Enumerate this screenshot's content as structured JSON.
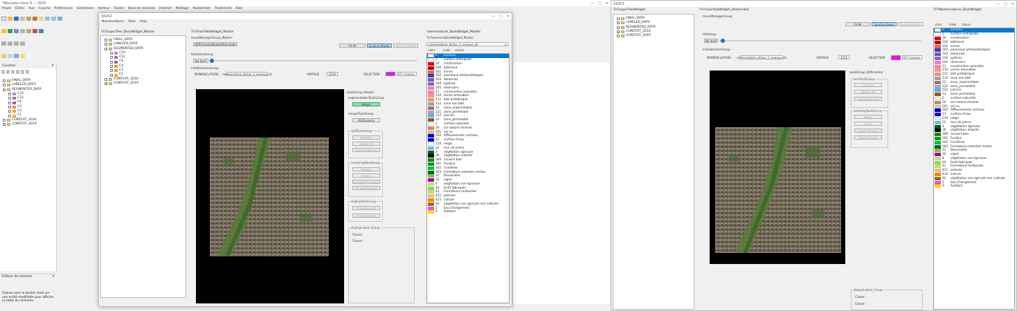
{
  "main_window": {
    "title": "*Nouveau zone 9 — QGIS",
    "menu": [
      "Projet",
      "Éditer",
      "Vue",
      "Couche",
      "Préférences",
      "Extensions",
      "Vecteur",
      "Raster",
      "Base de données",
      "Internet",
      "Maillage",
      "Rasterstats",
      "Traitement",
      "Aide"
    ],
    "layers_panel_title": "Couches",
    "layers": [
      {
        "name": "FINAL_DATA",
        "checked": false,
        "indent": 1
      },
      {
        "name": "LABELED_DATA",
        "checked": false,
        "indent": 1
      },
      {
        "name": "SEGMENTED_DATA",
        "checked": false,
        "indent": 1
      },
      {
        "name": "C10",
        "checked": false,
        "indent": 2,
        "color": "#b088c8"
      },
      {
        "name": "C12",
        "checked": false,
        "indent": 2,
        "color": "#a070b8"
      },
      {
        "name": "C6",
        "checked": false,
        "indent": 2,
        "color": "#9060a8"
      },
      {
        "name": "C4",
        "checked": false,
        "indent": 2,
        "color": "#d0a040"
      },
      {
        "name": "C2",
        "checked": false,
        "indent": 2,
        "color": "#e8a030"
      },
      {
        "name": "C1",
        "checked": false,
        "indent": 2,
        "color": "#f0b030"
      },
      {
        "name": "CONTEXT_2016",
        "checked": false,
        "indent": 1
      },
      {
        "name": "CONTEXT_2019",
        "checked": true,
        "indent": 1
      }
    ],
    "vertex_editor_title": "Éditeur de sommet",
    "vertex_editor_text": "Cliquez avec le bouton droit sur une entité modifiable pour afficher sa table de sommets."
  },
  "qgis_dialog": {
    "title": "QGIS3",
    "menu": [
      "Nomenclature",
      "Tools",
      "Help"
    ],
    "layer_tree_title": "TnTLayerTree_DockWidget_Master",
    "layers": [
      {
        "name": "FINAL_DATA",
        "checked": false,
        "indent": 1
      },
      {
        "name": "LABELED_DATA",
        "checked": false,
        "indent": 1
      },
      {
        "name": "SEGMENTED_DATA",
        "checked": false,
        "indent": 1
      },
      {
        "name": "C10",
        "checked": false,
        "indent": 2,
        "color": "#b088c8"
      },
      {
        "name": "C12",
        "checked": false,
        "indent": 2,
        "color": "#a070b8"
      },
      {
        "name": "C6",
        "checked": false,
        "indent": 2,
        "color": "#9060a8"
      },
      {
        "name": "C4",
        "checked": false,
        "indent": 2,
        "color": "#d0a040"
      },
      {
        "name": "C2",
        "checked": false,
        "indent": 2,
        "color": "#e8a030"
      },
      {
        "name": "C1",
        "checked": false,
        "indent": 2,
        "color": "#f0b030"
      },
      {
        "name": "CONTEXT_2016",
        "checked": false,
        "indent": 1
      },
      {
        "name": "CONTEXT_2019",
        "checked": true,
        "indent": 1
      }
    ],
    "center_title": "TnTmainToolWidget_Master",
    "move_group": "moveManagerGroup_Master",
    "refresh_btn": "AllTrCentroidSpatialReg mode",
    "fit_all": "Fit All",
    "synchro_btn": "Synchro Master",
    "synchro_slave": "Synchro Slave",
    "select_group": "tileSelectGroup",
    "no_level": "No level",
    "info_group": "infoSelectionGroup",
    "nomenclature_label": "NOMENCLATURE",
    "nomenclature_value": "nomenclature_dchan_3_niveaux_v0",
    "vintage_label": "VINTAGE",
    "vintage_value": "2019",
    "selection_label": "SELECTION",
    "selection_value": "0",
    "selection_text": "inconnu",
    "tools_master": "toolsGroup_Master",
    "tools_master_sub": "segmentationToolsGroup",
    "attr_btn": "Attach",
    "merge_group": "mergeToolsGroup",
    "merge_btn": "All Dynamic",
    "split_group": "splitToolsGroup",
    "split_btns": [
      "Undefine",
      "Delete All",
      "Delete Element"
    ],
    "recolor_group": "recoloringToolsGroup",
    "recolor_btns": [
      "Recolor",
      "Erase",
      "Compare Polygons",
      "Fill with Polygon"
    ],
    "display_group": "displayToolsGroup",
    "display_btns": [
      "Show Element",
      "Show Element"
    ],
    "labels_group": "displayLabels_Group",
    "classe1": "Classe :",
    "classe2": "Classe :",
    "nom_dock_title": "nomenclature_DockWidget_Master",
    "nom_sub": "TnTnomenclatureWidget_Master",
    "nom_dropdown": "nomenclature_dchan_3_niveaux_v0",
    "col_color": "color",
    "col_code": "code",
    "col_class": "classe"
  },
  "nomenclature": [
    {
      "code": "0",
      "label": "inconnu",
      "color": "#ffffff",
      "selected": true
    },
    {
      "code": "1",
      "label": "surface entropisée",
      "color": "#ffffff"
    },
    {
      "code": "10",
      "label": "construction",
      "color": "#e00000"
    },
    {
      "code": "100",
      "label": "bâtiment",
      "color": "#c00000"
    },
    {
      "code": "101",
      "label": "serres",
      "color": "#e06060"
    },
    {
      "code": "102",
      "label": "panneaux photovoltaïques",
      "color": "#4040a0"
    },
    {
      "code": "103",
      "label": "éoliennes",
      "color": "#6060c0"
    },
    {
      "code": "104",
      "label": "pylônes",
      "color": "#a060a0"
    },
    {
      "code": "105",
      "label": "réservoirs",
      "color": "#e080e0"
    },
    {
      "code": "11",
      "label": "construction amovible",
      "color": "#ff80a0"
    },
    {
      "code": "110",
      "label": "serres amovibles",
      "color": "#ff9090"
    },
    {
      "code": "111",
      "label": "bâti préfabriqué",
      "color": "#e0a060"
    },
    {
      "code": "112",
      "label": "zone non bâti",
      "color": "#a0a0a0"
    },
    {
      "code": "12",
      "label": "zone_imperméable",
      "color": "#808080"
    },
    {
      "code": "121",
      "label": "zone_perméable",
      "color": "#d090b0"
    },
    {
      "code": "122",
      "label": "piscine",
      "color": "#40c0e0"
    },
    {
      "code": "13",
      "label": "zone_perméable",
      "color": "#a05020"
    },
    {
      "code": "2",
      "label": "surface naturelle",
      "color": "#ffffff"
    },
    {
      "code": "20",
      "label": "sol naturel minéral",
      "color": "#c09060"
    },
    {
      "code": "201",
      "label": "sol nu",
      "color": "#d0c0a0"
    },
    {
      "code": "202",
      "label": "Affleurements rocheux",
      "color": "#0000c0"
    },
    {
      "code": "21",
      "label": "surface d'eau",
      "color": "#0000ff"
    },
    {
      "code": "210",
      "label": "neige",
      "color": "#ffffff"
    },
    {
      "code": "22",
      "label": "mur de pierre",
      "color": "#60c0ff"
    },
    {
      "code": "3",
      "label": "végétation ligneuse",
      "color": "#006000"
    },
    {
      "code": "30",
      "label": "végétation arborée",
      "color": "#000000"
    },
    {
      "code": "300",
      "label": "couvert bois",
      "color": "#208020"
    },
    {
      "code": "301",
      "label": "Feuillus",
      "color": "#00a000"
    },
    {
      "code": "302",
      "label": "Conifères",
      "color": "#00c040"
    },
    {
      "code": "303",
      "label": "Formations arborées mixtes",
      "color": "#006030"
    },
    {
      "code": "31",
      "label": "Broussaille",
      "color": "#80c040"
    },
    {
      "code": "32",
      "label": "vigne",
      "color": "#a000a0"
    },
    {
      "code": "4",
      "label": "végétation non ligneuse",
      "color": "#c0e080"
    },
    {
      "code": "40",
      "label": "forêt fabriqués",
      "color": "#a0d060"
    },
    {
      "code": "41",
      "label": "Formations herbacées",
      "color": "#c0e060"
    },
    {
      "code": "411",
      "label": "pelouse",
      "color": "#e0c080"
    },
    {
      "code": "412",
      "label": "culture",
      "color": "#ff8000"
    },
    {
      "code": "42",
      "label": "végétation non agricole non cultivée",
      "color": "#808000"
    },
    {
      "code": "5",
      "label": "Eau Changement",
      "color": "#ff40ff"
    },
    {
      "code": "6",
      "label": "Artefact",
      "color": "#ffd700"
    }
  ],
  "right_qgis": {
    "title": "QGIS3",
    "layer_tree_title": "TnTLayerTreeWidget",
    "layers": [
      {
        "name": "FINAL_DATA",
        "checked": false,
        "indent": 1
      },
      {
        "name": "LABELED_DATA",
        "checked": false,
        "indent": 1
      },
      {
        "name": "SEGMENTED_DATA",
        "checked": false,
        "indent": 1
      },
      {
        "name": "CONTEXT_2016",
        "checked": true,
        "indent": 1
      },
      {
        "name": "CONTEXT_2019",
        "checked": false,
        "indent": 1
      }
    ],
    "center_title": "TnTmainToolWidget_DiHerential",
    "move_group": "moveManagerGroup",
    "fit_all": "Fit All",
    "synchro_btn": "Synchro Items",
    "synchro_slave": "Synchro Items",
    "select_group": "tileGroup",
    "no_level": "No level",
    "info_group": "infoSelectionGroup",
    "nomenclature_label": "NOMENCLATURE",
    "nomenclature_value": "nomenclature_dchan_3_niveaux_v0",
    "vintage_label": "VINTAGE",
    "vintage_value": "2016",
    "selection_label": "SELECTION",
    "selection_value": "0",
    "selection_text": "inconnu",
    "tools_group": "toolsGroup_Differential",
    "lock_group": "lockToolsGroup",
    "lock_btns": [
      "Locking",
      "Delete All",
      "Delete Element"
    ],
    "select_tools_group": "selectingToolsGroup",
    "select_btns": [
      "Select",
      "Undo",
      "Layer Polygon",
      "Select Polygon"
    ],
    "labels_group": "displayLabels_Group",
    "classe1": "Classe :",
    "classe2": "Classe :",
    "nom_dock_title": "TnTNomenclature_DockWidget",
    "col_color": "color",
    "col_code": "code",
    "col_class": "classe"
  },
  "far_left_partial": {
    "title": "QGIS3"
  }
}
